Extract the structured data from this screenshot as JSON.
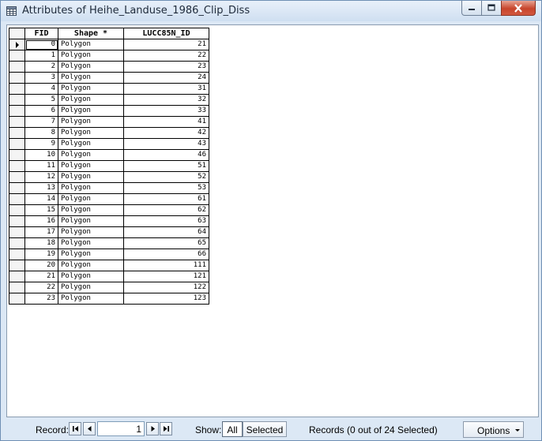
{
  "window": {
    "title": "Attributes of Heihe_Landuse_1986_Clip_Diss"
  },
  "table": {
    "columns": [
      "FID",
      "Shape *",
      "LUCC85N_ID"
    ],
    "rows": [
      [
        "0",
        "Polygon",
        "21"
      ],
      [
        "1",
        "Polygon",
        "22"
      ],
      [
        "2",
        "Polygon",
        "23"
      ],
      [
        "3",
        "Polygon",
        "24"
      ],
      [
        "4",
        "Polygon",
        "31"
      ],
      [
        "5",
        "Polygon",
        "32"
      ],
      [
        "6",
        "Polygon",
        "33"
      ],
      [
        "7",
        "Polygon",
        "41"
      ],
      [
        "8",
        "Polygon",
        "42"
      ],
      [
        "9",
        "Polygon",
        "43"
      ],
      [
        "10",
        "Polygon",
        "46"
      ],
      [
        "11",
        "Polygon",
        "51"
      ],
      [
        "12",
        "Polygon",
        "52"
      ],
      [
        "13",
        "Polygon",
        "53"
      ],
      [
        "14",
        "Polygon",
        "61"
      ],
      [
        "15",
        "Polygon",
        "62"
      ],
      [
        "16",
        "Polygon",
        "63"
      ],
      [
        "17",
        "Polygon",
        "64"
      ],
      [
        "18",
        "Polygon",
        "65"
      ],
      [
        "19",
        "Polygon",
        "66"
      ],
      [
        "20",
        "Polygon",
        "111"
      ],
      [
        "21",
        "Polygon",
        "121"
      ],
      [
        "22",
        "Polygon",
        "122"
      ],
      [
        "23",
        "Polygon",
        "123"
      ]
    ],
    "current_row": 0
  },
  "statusbar": {
    "record_label": "Record:",
    "record_value": "1",
    "show_label": "Show:",
    "all_label": "All",
    "selected_label": "Selected",
    "records_text": "Records (0 out of 24 Selected)",
    "options_label": "Options"
  }
}
